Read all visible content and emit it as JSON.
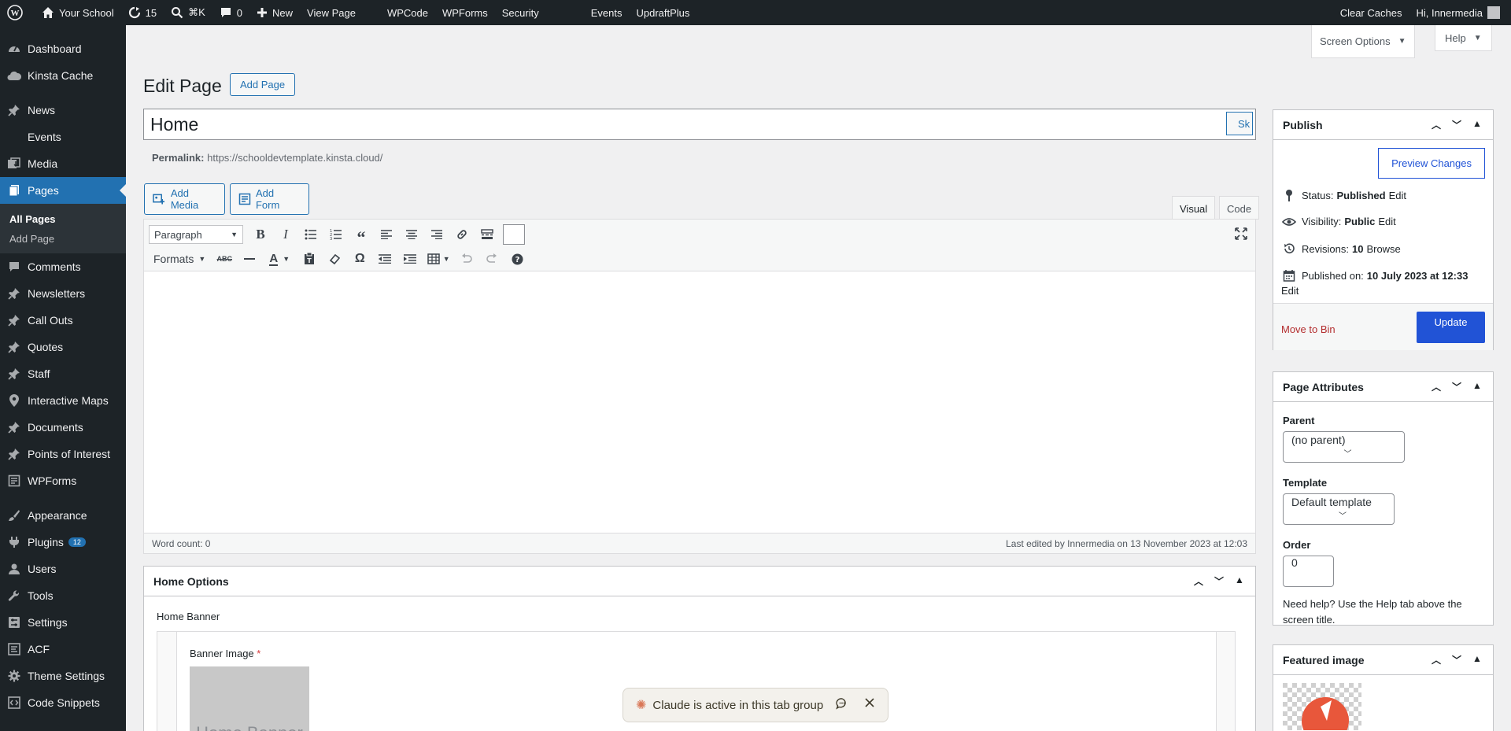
{
  "adminbar": {
    "site_name": "Your School",
    "updates_count": "15",
    "search_shortcut": "⌘K",
    "comments_count": "0",
    "new_label": "New",
    "view_page": "View Page",
    "wpcode": "WPCode",
    "wpforms": "WPForms",
    "security": "Security",
    "events": "Events",
    "updraftplus": "UpdraftPlus",
    "clear_caches": "Clear Caches",
    "greeting": "Hi, Innermedia"
  },
  "sidebar": {
    "items": [
      {
        "label": "Dashboard",
        "icon": "dashboard-icon"
      },
      {
        "label": "Kinsta Cache",
        "icon": "cloud-icon"
      },
      {
        "label": "News",
        "icon": "pin-icon"
      },
      {
        "label": "Events",
        "icon": "blank-icon"
      },
      {
        "label": "Media",
        "icon": "media-icon"
      },
      {
        "label": "Pages",
        "icon": "pages-icon"
      },
      {
        "label": "Comments",
        "icon": "comments-icon"
      },
      {
        "label": "Newsletters",
        "icon": "pin-icon"
      },
      {
        "label": "Call Outs",
        "icon": "pin-icon"
      },
      {
        "label": "Quotes",
        "icon": "pin-icon"
      },
      {
        "label": "Staff",
        "icon": "pin-icon"
      },
      {
        "label": "Interactive Maps",
        "icon": "location-icon"
      },
      {
        "label": "Documents",
        "icon": "pin-icon"
      },
      {
        "label": "Points of Interest",
        "icon": "pin-icon"
      },
      {
        "label": "WPForms",
        "icon": "forms-icon"
      },
      {
        "label": "Appearance",
        "icon": "brush-icon"
      },
      {
        "label": "Plugins",
        "icon": "plugin-icon",
        "badge": "12"
      },
      {
        "label": "Users",
        "icon": "users-icon"
      },
      {
        "label": "Tools",
        "icon": "wrench-icon"
      },
      {
        "label": "Settings",
        "icon": "settings-icon"
      },
      {
        "label": "ACF",
        "icon": "acf-icon"
      },
      {
        "label": "Theme Settings",
        "icon": "gear-icon"
      },
      {
        "label": "Code Snippets",
        "icon": "code-icon"
      }
    ],
    "submenu": {
      "all_pages": "All Pages",
      "add_page": "Add Page"
    }
  },
  "header": {
    "screen_options": "Screen Options",
    "help": "Help",
    "page_title": "Edit Page",
    "add_page_button": "Add Page"
  },
  "post": {
    "title": "Home",
    "side_button": "Sk",
    "permalink_label": "Permalink:",
    "permalink_url": "https://schooldevtemplate.kinsta.cloud/"
  },
  "editor": {
    "add_media": "Add Media",
    "add_form": "Add Form",
    "tab_visual": "Visual",
    "tab_code": "Code",
    "format_select": "Paragraph",
    "formats_label": "Formats",
    "word_count": "Word count: 0",
    "last_edited": "Last edited by Innermedia on 13 November 2023 at 12:03"
  },
  "publish": {
    "title": "Publish",
    "preview_button": "Preview Changes",
    "status_label": "Status:",
    "status_value": "Published",
    "visibility_label": "Visibility:",
    "visibility_value": "Public",
    "revisions_label": "Revisions:",
    "revisions_value": "10",
    "browse": "Browse",
    "published_label": "Published on:",
    "published_value": "10 July 2023 at 12:33",
    "edit": "Edit",
    "move_to_bin": "Move to Bin",
    "update_button": "Update"
  },
  "page_attributes": {
    "title": "Page Attributes",
    "parent_label": "Parent",
    "parent_value": "(no parent)",
    "template_label": "Template",
    "template_value": "Default template",
    "order_label": "Order",
    "order_value": "0",
    "help_text": "Need help? Use the Help tab above the screen title."
  },
  "featured_image": {
    "title": "Featured image"
  },
  "home_options": {
    "title": "Home Options",
    "home_banner_label": "Home Banner",
    "banner_image_label": "Banner Image",
    "required_mark": "*",
    "placeholder_text": "Home Banner"
  },
  "claude_bar": {
    "text": "Claude is active in this tab group"
  },
  "colors": {
    "accent": "#2271b1",
    "adminbar": "#1d2327",
    "publish_button": "#2153d6",
    "bin_red": "#b32d2e"
  }
}
